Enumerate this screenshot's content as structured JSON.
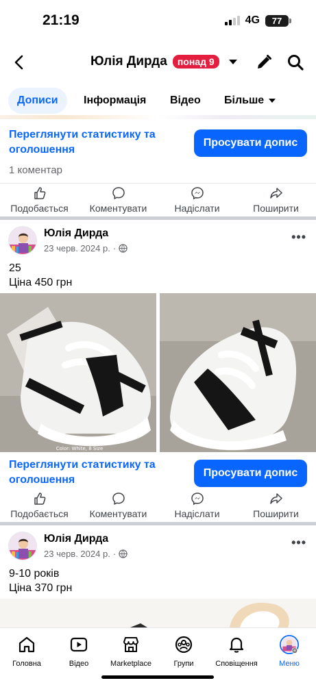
{
  "status": {
    "time": "21:19",
    "network": "4G",
    "battery": "77"
  },
  "header": {
    "title": "Юлія Дирда",
    "badge": "понад 9"
  },
  "tabs": [
    {
      "label": "Дописи"
    },
    {
      "label": "Інформація"
    },
    {
      "label": "Відео"
    },
    {
      "label": "Більше"
    }
  ],
  "promo": {
    "stats_link": "Переглянути статистику та оголошення",
    "boost_button": "Просувати допис"
  },
  "comment_count": "1 коментар",
  "actions": {
    "like": "Подобається",
    "comment": "Коментувати",
    "send": "Надіслати",
    "share": "Поширити"
  },
  "posts": [
    {
      "author": "Юлія Дирда",
      "date": "23 черв. 2024 р.",
      "line1": "25",
      "line2": "Ціна 450 грн",
      "photo_caption": "Color: White, 8 Size"
    },
    {
      "author": "Юлія Дирда",
      "date": "23 черв. 2024 р.",
      "line1": "9-10 років",
      "line2": "Ціна 370 грн"
    }
  ],
  "bottom_nav": [
    {
      "label": "Головна",
      "icon": "home-icon"
    },
    {
      "label": "Відео",
      "icon": "video-icon"
    },
    {
      "label": "Marketplace",
      "icon": "marketplace-icon"
    },
    {
      "label": "Групи",
      "icon": "groups-icon"
    },
    {
      "label": "Сповіщення",
      "icon": "bell-icon"
    },
    {
      "label": "Меню",
      "icon": "menu-avatar-icon"
    }
  ],
  "colors": {
    "accent": "#0866ff",
    "badge": "#e41e3f",
    "muted": "#65676b"
  }
}
